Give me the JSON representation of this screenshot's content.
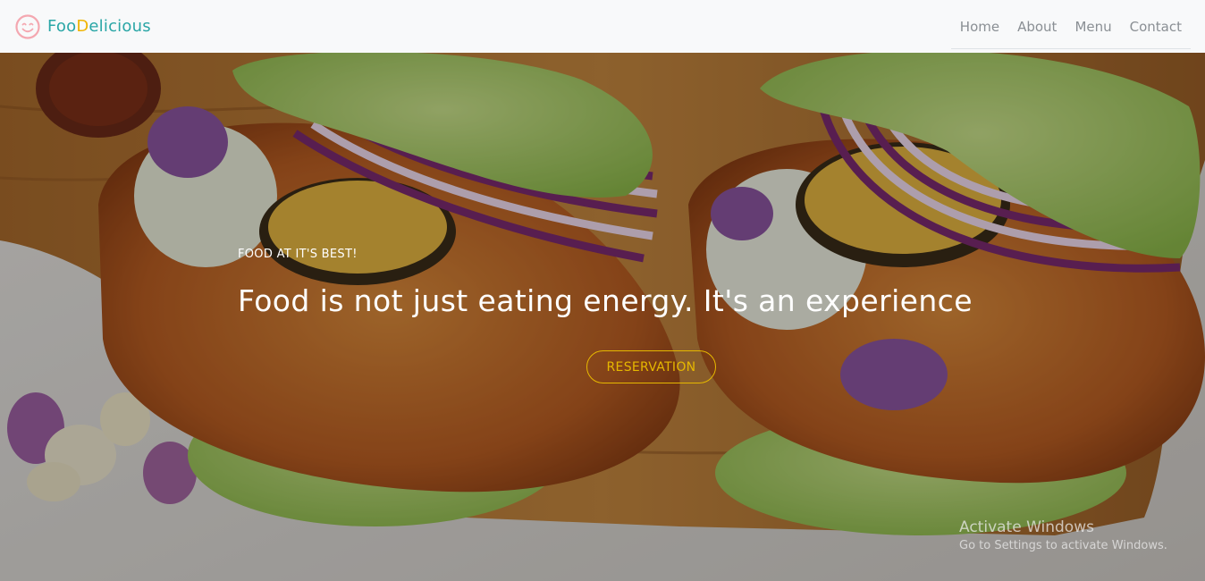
{
  "brand": {
    "part1": "Foo",
    "part2": "D",
    "part3": "elicious",
    "icon": "smiley-icon",
    "colors": {
      "teal": "#2aa6a6",
      "yellow": "#f0b400",
      "icon": "#f4a7b0"
    }
  },
  "nav": {
    "items": [
      {
        "label": "Home"
      },
      {
        "label": "About"
      },
      {
        "label": "Menu"
      },
      {
        "label": "Contact"
      }
    ]
  },
  "hero": {
    "subtitle": "FOOD AT IT'S BEST!",
    "title": "Food is not just eating energy. It's an experience",
    "button_label": "RESERVATION",
    "accent": "#e6b800"
  },
  "watermark": {
    "title": "Activate Windows",
    "subtitle": "Go to Settings to activate Windows."
  }
}
